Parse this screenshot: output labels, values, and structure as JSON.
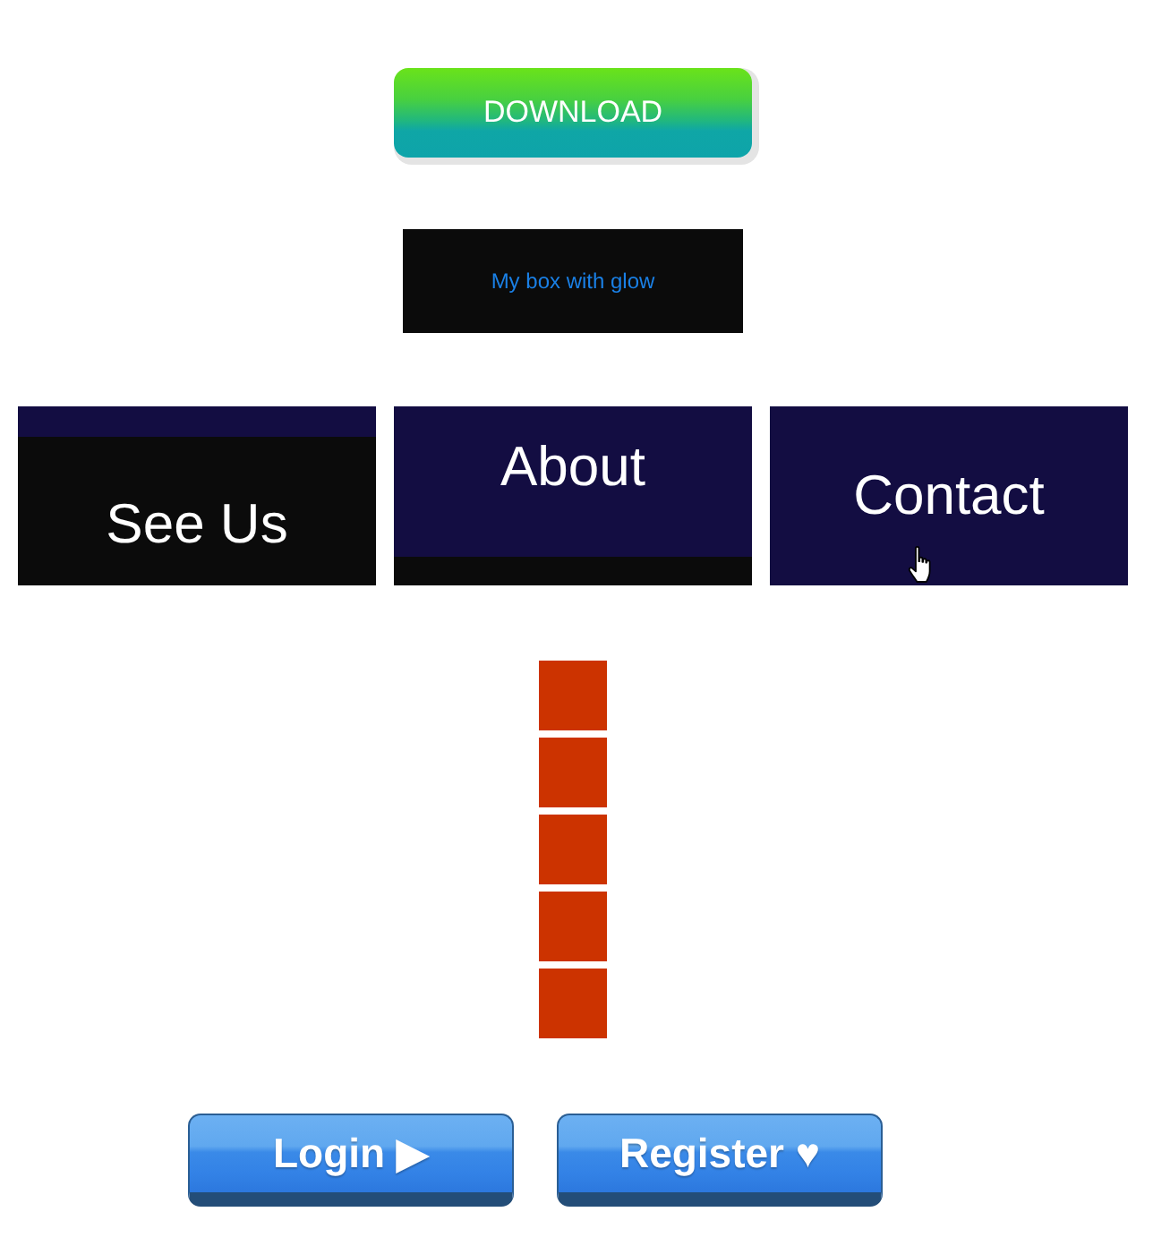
{
  "download_button": {
    "label": "DOWNLOAD"
  },
  "glow_box": {
    "text": "My box with glow"
  },
  "tiles": [
    {
      "label": "See Us",
      "kind": "lower",
      "hovered": false
    },
    {
      "label": "About",
      "kind": "upper",
      "hovered": false
    },
    {
      "label": "Contact",
      "kind": "centered",
      "hovered": true
    }
  ],
  "blocks": [
    {
      "color": "#cc3300"
    },
    {
      "color": "#cc3300"
    },
    {
      "color": "#cc3300"
    },
    {
      "color": "#cc3300"
    },
    {
      "color": "#cc3300"
    }
  ],
  "buttons": [
    {
      "label": "Login ▶"
    },
    {
      "label": "Register ♥"
    }
  ]
}
